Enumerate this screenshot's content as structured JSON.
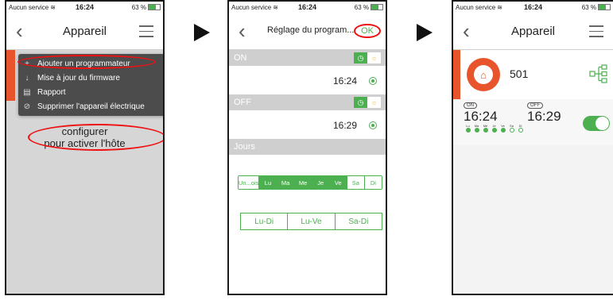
{
  "status": {
    "carrier": "Aucun service",
    "time": "16:24",
    "battery": "63 %"
  },
  "panel1": {
    "title": "Appareil",
    "menu": [
      {
        "icon": "+",
        "label": "Ajouter un programmateur"
      },
      {
        "icon": "↓",
        "label": "Mise à jour du firmware"
      },
      {
        "icon": "▤",
        "label": "Rapport"
      },
      {
        "icon": "⊘",
        "label": "Supprimer l'appareil électrique"
      }
    ],
    "config_line1": "configurer",
    "config_line2": "pour activer l'hôte"
  },
  "panel2": {
    "title": "Réglage du program...",
    "ok": "OK",
    "on_label": "ON",
    "on_time": "16:24",
    "off_label": "OFF",
    "off_time": "16:29",
    "days_label": "Jours",
    "days": [
      {
        "label": "Un...ois",
        "selected": false
      },
      {
        "label": "Lu",
        "selected": true
      },
      {
        "label": "Ma",
        "selected": true
      },
      {
        "label": "Me",
        "selected": true
      },
      {
        "label": "Je",
        "selected": true
      },
      {
        "label": "Ve",
        "selected": true
      },
      {
        "label": "Sa",
        "selected": false
      },
      {
        "label": "Di",
        "selected": false
      }
    ],
    "ranges": [
      "Lu-Di",
      "Lu-Ve",
      "Sa-Di"
    ]
  },
  "panel3": {
    "title": "Appareil",
    "device_name": "501",
    "on_tag": "ON",
    "off_tag": "OFF",
    "on_time": "16:24",
    "off_time": "16:29",
    "dots": [
      {
        "label": "Lu",
        "filled": true
      },
      {
        "label": "Ma",
        "filled": true
      },
      {
        "label": "Me",
        "filled": true
      },
      {
        "label": "Je",
        "filled": true
      },
      {
        "label": "Ve",
        "filled": true
      },
      {
        "label": "Sa",
        "filled": false
      },
      {
        "label": "Di",
        "filled": false
      }
    ]
  },
  "colors": {
    "accent": "#4caf50",
    "brand": "#e8542c",
    "highlight": "#e11111"
  }
}
